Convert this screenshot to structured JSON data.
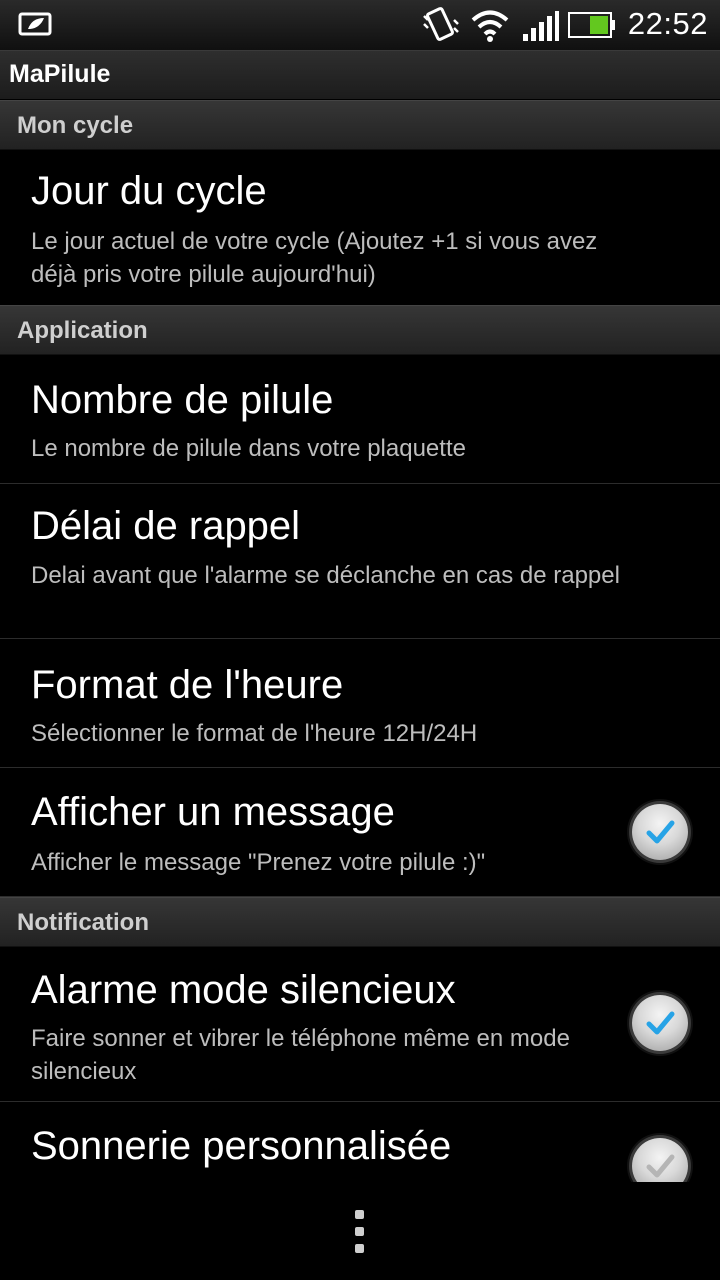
{
  "status_bar": {
    "time": "22:52",
    "icons": [
      "app-notification-icon",
      "vibrate-icon",
      "wifi-icon",
      "signal-icon",
      "battery-icon"
    ]
  },
  "app": {
    "title": "MaPilule"
  },
  "sections": [
    {
      "header": "Mon cycle"
    },
    {
      "header": "Application"
    },
    {
      "header": "Notification"
    }
  ],
  "items": {
    "jour_du_cycle": {
      "title": "Jour du cycle",
      "summary": "Le jour actuel de votre cycle (Ajoutez +1 si vous avez déjà pris votre pilule aujourd'hui)"
    },
    "nombre_de_pilule": {
      "title": "Nombre de pilule",
      "summary": "Le nombre de pilule dans votre plaquette"
    },
    "delai_de_rappel": {
      "title": "Délai de rappel",
      "summary": "Delai avant que l'alarme se déclanche en cas de rappel"
    },
    "format_heure": {
      "title": "Format de l'heure",
      "summary": "Sélectionner le format de l'heure 12H/24H"
    },
    "afficher_message": {
      "title": "Afficher un message",
      "summary": "Afficher le message \"Prenez votre pilule :)\"",
      "checked": true
    },
    "alarme_silencieux": {
      "title": "Alarme mode silencieux",
      "summary": "Faire sonner et vibrer le téléphone même en mode silencieux",
      "checked": true
    },
    "sonnerie": {
      "title": "Sonnerie personnalisée",
      "checked": false
    }
  },
  "colors": {
    "check_accent": "#27a3e6",
    "background": "#000000"
  }
}
